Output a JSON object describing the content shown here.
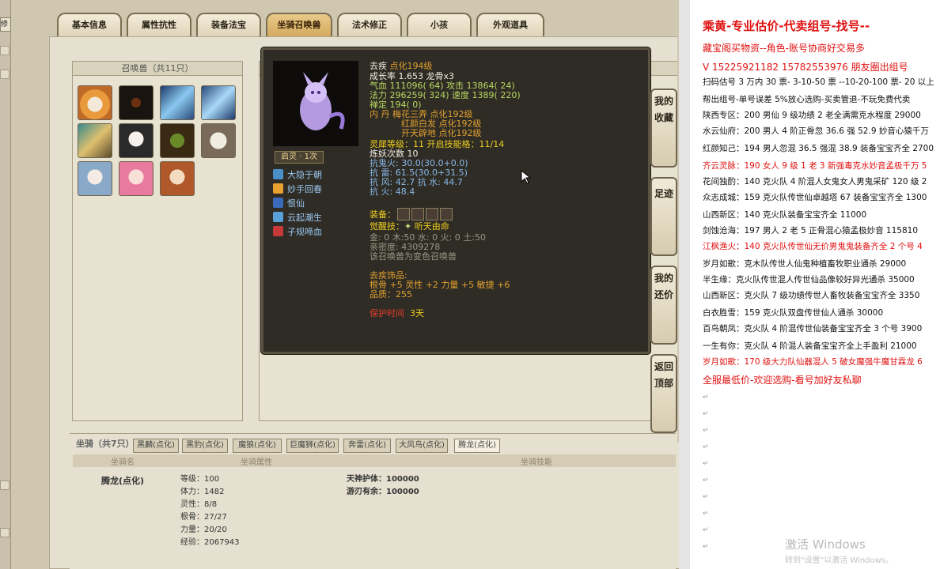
{
  "left_strip": {
    "label": "修正"
  },
  "tabs": [
    {
      "label": "基本信息"
    },
    {
      "label": "属性抗性"
    },
    {
      "label": "装备法宝"
    },
    {
      "label": "坐骑召唤兽"
    },
    {
      "label": "法术修正"
    },
    {
      "label": "小孩"
    },
    {
      "label": "外观道具"
    }
  ],
  "pet_list": {
    "title": "召唤兽（共11只）"
  },
  "detail": {
    "title": "去疾",
    "name_line": "去疾 ",
    "name_suffix": "点化194级",
    "growth": "成长率 1.653 龙骨x3",
    "hp": "气血 111096( 64) 攻击 13864( 24)",
    "mp": "法力 296259( 324) 速度 1389( 220)",
    "defense": "禅定 194( 0)",
    "inner1": "内  丹 梅花三弄 点化192级",
    "inner2": "红颜白发 点化192级",
    "inner3": "开天辟地 点化192级",
    "awaken_badge": "启灵 · 1次",
    "spirit": "灵犀等级：11 开启技能格：11/14",
    "refine": "炼妖次数 10",
    "res1": "抗鬼火: 30.0(30.0+0.0)",
    "res2": "抗   雷: 61.5(30.0+31.5)",
    "res3": "抗   风: 42.7 抗   水: 44.7",
    "res4": "抗   火: 48.4",
    "equip_label": "装备：",
    "awaken_label": "觉醒技：",
    "awaken_skill": "听天由命",
    "elements": "金: 0 木:50 水: 0 火: 0 土:50",
    "intimacy": "亲密度: 4309278",
    "note": "该召唤兽为变色召唤兽",
    "orn_title": "去疾饰品:",
    "orn_stats": "根骨 +5 灵性 +2 力量 +5 敏捷 +6",
    "quality": "品质：255",
    "protect_label": "保护时间",
    "protect_value": "3天",
    "skills": [
      "大隐于朝",
      "妙手回春",
      "恨仙",
      "云起潮生",
      "子规啼血"
    ]
  },
  "side_buttons": [
    {
      "label": "我的收藏"
    },
    {
      "label": "足迹"
    },
    {
      "label": "我的还价"
    },
    {
      "label": "返回顶部"
    }
  ],
  "mount": {
    "title": "坐骑（共7只）",
    "tabs": [
      "黑麟(点化)",
      "黑豹(点化)",
      "魔狼(点化)",
      "巨魔狮(点化)",
      "奔雷(点化)",
      "大风鸟(点化)",
      "腾龙(点化)"
    ],
    "col_name": "坐骑名",
    "col_attr": "坐骑属性",
    "col_skill": "坐骑技能",
    "name": "腾龙(点化)",
    "stats": [
      "等级：100",
      "体力：1482",
      "灵性：8/8",
      "根骨：27/27",
      "力量：20/20",
      "经验：2067943"
    ],
    "skills": [
      "天神护体：100000",
      "游刃有余：100000"
    ]
  },
  "doc": {
    "title": "乘黄-专业估价-代卖组号-找号--",
    "lines": [
      {
        "text": "藏宝阁买物资--角色-账号协商好交易多",
        "red": true
      },
      {
        "text": "V 15225921182   15782553976 朋友圈出组号",
        "red": true
      },
      {
        "text": "扫码估号 3 万内 30 票- 3-10-50 票  --10-20-100 票- 20 以上",
        "red": false
      },
      {
        "text": "帮出组号-单号误差 5%放心选购-买卖管退-不玩免费代卖",
        "red": false
      },
      {
        "text": "陕西专区：200 男仙 9 级功绩 2 老全满需克水程度 29000",
        "red": false
      },
      {
        "text": "水云仙府：200 男人 4 阶正骨忽 36.6 强 52.9 妙音心猿千万",
        "red": false
      },
      {
        "text": "红颜知己：194 男人忽混 36.5 强混 38.9 装备宝宝齐全 2700",
        "red": false
      },
      {
        "text": "齐云灵脉：190 女人 9 级 1 老 3 新强毒克水妙音孟极千万 5",
        "red": true
      },
      {
        "text": "花间独酌：140 克火队 4 阶混人女鬼女人男鬼采矿 120 级 2",
        "red": false
      },
      {
        "text": "众志成城：159 克火队传世仙卓越塔 67 装备宝宝齐全 1300",
        "red": false
      },
      {
        "text": "山西新区：140 克火队装备宝宝齐全 11000",
        "red": false
      },
      {
        "text": "剑蚀沧海：197 男人 2 老 5 正骨混心猿孟极妙音 115810",
        "red": false
      },
      {
        "text": "江枫渔火：140 克火队传世仙无价男鬼鬼装备齐全 2 个号 4",
        "red": true
      },
      {
        "text": "岁月如歌：克木队传世人仙鬼种植畜牧职业通杀 29000",
        "red": false
      },
      {
        "text": "半生缘：克火队传世混人传世仙品像较好异光通杀 35000",
        "red": false
      },
      {
        "text": "山西新区：克火队 7 级功绩传世人畜牧装备宝宝齐全 3350",
        "red": false
      },
      {
        "text": "白衣胜雪：159 克火队双盘传世仙人通杀 30000",
        "red": false
      },
      {
        "text": "百鸟朝凤：克火队 4 阶混传世仙装备宝宝齐全 3 个号 3900",
        "red": false
      },
      {
        "text": "一生有你：克火队 4 阶混人装备宝宝齐全上手盈利 21000",
        "red": false
      },
      {
        "text": "岁月如歌：170 级大力队仙器混人 5 破女魔强牛魔甘霖龙 6",
        "red": true
      },
      {
        "text": "全服最低价-欢迎选购-看号加好友私聊",
        "red": true
      }
    ],
    "return_mark": "↵",
    "watermark1": "激活 Windows",
    "watermark2": "转到\"设置\"以激活 Windows。"
  }
}
